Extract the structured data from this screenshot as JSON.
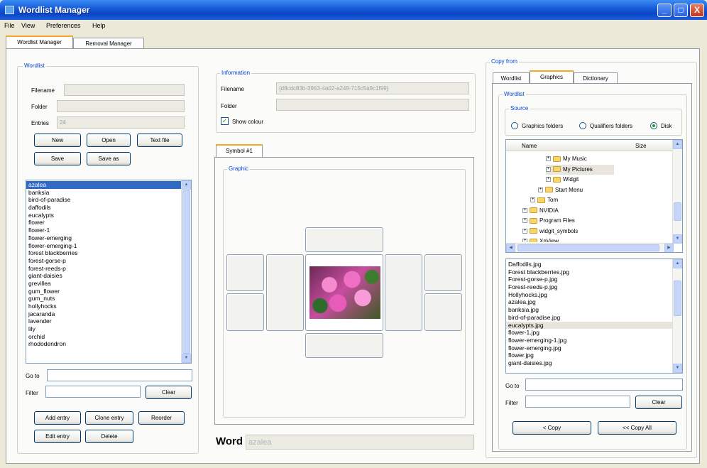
{
  "window": {
    "title": "Wordlist Manager",
    "buttons": [
      "_",
      "□",
      "X"
    ]
  },
  "menu": [
    "File",
    "View",
    "Preferences",
    "Help"
  ],
  "main_tabs": [
    "Wordlist Manager",
    "Removal Manager"
  ],
  "wordlist": {
    "group_label": "Wordlist",
    "filename_label": "Filename",
    "folder_label": "Folder",
    "entries_label": "Entries",
    "entries_value": "24",
    "buttons": {
      "new": "New",
      "open": "Open",
      "text_file": "Text file",
      "save": "Save",
      "save_as": "Save as"
    },
    "words": [
      "azalea",
      "banksia",
      "bird-of-paradise",
      "daffodils",
      "eucalypts",
      "flower",
      "flower-1",
      "flower-emerging",
      "flower-emerging-1",
      "forest blackberries",
      "forest-gorse-p",
      "forest-reeds-p",
      "giant-daisies",
      "grevillea",
      "gum_flower",
      "gum_nuts",
      "hollyhocks",
      "jacaranda",
      "lavender",
      "lily",
      "orchid",
      "rhododendron"
    ],
    "selected_index": 0,
    "goto_label": "Go to",
    "filter_label": "Filter",
    "clear_label": "Clear",
    "actions": {
      "add": "Add entry",
      "clone": "Clone entry",
      "reorder": "Reorder",
      "edit": "Edit entry",
      "delete": "Delete"
    }
  },
  "information": {
    "group_label": "Information",
    "filename_label": "Filename",
    "filename_value": "{d8cdc83b-3963-4a02-a249-715c5a9c1f99}",
    "folder_label": "Folder",
    "show_colour_label": "Show colour",
    "show_colour_checked": true
  },
  "symbol": {
    "tab_label": "Symbol #1",
    "graphic_label": "Graphic",
    "image_icon": "pink-azalea-photo"
  },
  "word": {
    "label": "Word",
    "value": "azalea"
  },
  "copy_from": {
    "group_label": "Copy from",
    "tabs": [
      "Wordlist",
      "Graphics",
      "Dictionary"
    ],
    "active_tab": "Graphics",
    "wordlist_label": "Wordlist",
    "source_label": "Source",
    "source_options": [
      "Graphics folders",
      "Qualifiers folders",
      "Disk"
    ],
    "source_selected": "Disk",
    "tree_headers": [
      "Name",
      "Size"
    ],
    "tree": [
      {
        "label": "My Music",
        "indent": 4,
        "expand": "+"
      },
      {
        "label": "My Pictures",
        "indent": 4,
        "expand": "+",
        "highlighted": true
      },
      {
        "label": "Widgit",
        "indent": 4,
        "expand": "+"
      },
      {
        "label": "Start Menu",
        "indent": 3,
        "expand": "+"
      },
      {
        "label": "Tom",
        "indent": 2,
        "expand": "+"
      },
      {
        "label": "NVIDIA",
        "indent": 1,
        "expand": "+"
      },
      {
        "label": "Program Files",
        "indent": 1,
        "expand": "+"
      },
      {
        "label": "widgit_symbols",
        "indent": 1,
        "expand": "+"
      },
      {
        "label": "XnView",
        "indent": 1,
        "expand": "+"
      }
    ],
    "files": [
      "Daffodils.jpg",
      "Forest blackberries.jpg",
      "Forest-gorse-p.jpg",
      "Forest-reeds-p.jpg",
      "Hollyhocks.jpg",
      "azalea.jpg",
      "banksia.jpg",
      "bird-of-paradise.jpg",
      "eucalypts.jpg",
      "flower-1.jpg",
      "flower-emerging-1.jpg",
      "flower-emerging.jpg",
      "flower.jpg",
      "giant-daisies.jpg"
    ],
    "file_highlight_index": 8,
    "goto_label": "Go to",
    "filter_label": "Filter",
    "clear_label": "Clear",
    "copy_label": "< Copy",
    "copy_all_label": "<< Copy All"
  },
  "colors": {
    "title_bar": "#0b45c4",
    "selection": "#316ac5",
    "group_label": "#0046d5",
    "background": "#ece9d8"
  }
}
